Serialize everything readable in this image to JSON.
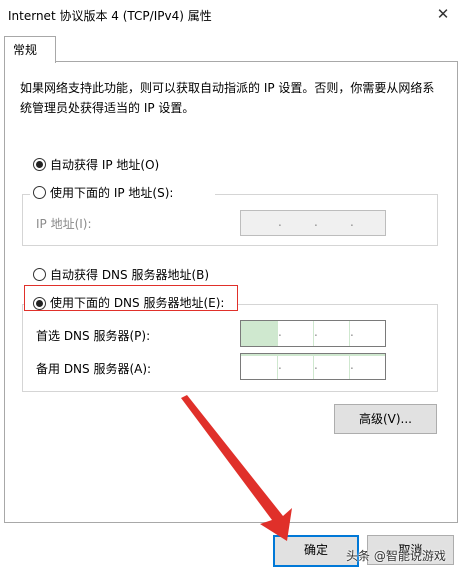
{
  "window": {
    "title": "Internet 协议版本 4 (TCP/IPv4) 属性",
    "close_glyph": "✕"
  },
  "tabs": [
    {
      "label": "常规"
    }
  ],
  "description": "如果网络支持此功能，则可以获取自动指派的 IP 设置。否则，你需要从网络系统管理员处获得适当的 IP 设置。",
  "ip_section": {
    "auto_label": "自动获得 IP 地址(O)",
    "auto_selected": true,
    "manual_label": "使用下面的 IP 地址(S):",
    "manual_selected": false,
    "ip_address_label": "IP 地址(I):"
  },
  "dns_section": {
    "auto_label": "自动获得 DNS 服务器地址(B)",
    "auto_selected": false,
    "manual_label": "使用下面的 DNS 服务器地址(E):",
    "manual_selected": true,
    "preferred_label": "首选 DNS 服务器(P):",
    "alternate_label": "备用 DNS 服务器(A):"
  },
  "ip_dot": ".",
  "buttons": {
    "advanced": "高级(V)...",
    "ok": "确定",
    "cancel": "取消"
  },
  "watermark": "头条 @智能说游戏",
  "colors": {
    "annotation_red": "#e0302a",
    "focus_blue": "#0078d7",
    "field_highlight": "#cfe8cf"
  }
}
